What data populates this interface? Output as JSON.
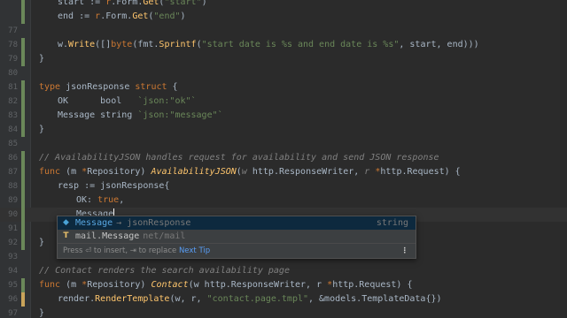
{
  "editor": {
    "lines": [
      {
        "num": "",
        "parts": [
          [
            "",
            "start := "
          ],
          [
            "kw",
            "r"
          ],
          [
            "",
            ".Form."
          ],
          [
            "fn",
            "Get"
          ],
          [
            "",
            "("
          ],
          [
            "str",
            "\"start\""
          ],
          [
            "",
            ")"
          ]
        ]
      },
      {
        "num": "",
        "parts": [
          [
            "",
            "end := "
          ],
          [
            "kw",
            "r"
          ],
          [
            "",
            ".Form."
          ],
          [
            "fn",
            "Get"
          ],
          [
            "",
            "("
          ],
          [
            "str",
            "\"end\""
          ],
          [
            "",
            ")"
          ]
        ]
      },
      {
        "num": "77",
        "parts": []
      },
      {
        "num": "78",
        "parts": [
          [
            "",
            "w."
          ],
          [
            "fn",
            "Write"
          ],
          [
            "",
            "([]"
          ],
          [
            "kw",
            "byte"
          ],
          [
            "",
            "(fmt."
          ],
          [
            "fn",
            "Sprintf"
          ],
          [
            "",
            "("
          ],
          [
            "str",
            "\"start date is %s and end date is %s\""
          ],
          [
            "",
            ", start, end)))"
          ]
        ]
      },
      {
        "num": "79",
        "parts": [
          [
            "",
            "}"
          ]
        ]
      },
      {
        "num": "80",
        "parts": []
      },
      {
        "num": "81",
        "parts": [
          [
            "kw",
            "type "
          ],
          [
            "",
            "jsonResponse "
          ],
          [
            "kw",
            "struct "
          ],
          [
            "",
            "{"
          ]
        ]
      },
      {
        "num": "82",
        "parts": [
          [
            "",
            "OK      bool   "
          ],
          [
            "tag",
            "`json:\"ok\"`"
          ]
        ]
      },
      {
        "num": "83",
        "parts": [
          [
            "",
            "Message string "
          ],
          [
            "tag",
            "`json:\"message\"`"
          ]
        ]
      },
      {
        "num": "84",
        "parts": [
          [
            "",
            "}"
          ]
        ]
      },
      {
        "num": "85",
        "parts": []
      },
      {
        "num": "86",
        "parts": [
          [
            "cmt",
            "// AvailabilityJSON handles request for availability and send JSON response"
          ]
        ]
      },
      {
        "num": "87",
        "parts": [
          [
            "kw",
            "func "
          ],
          [
            "",
            "(m "
          ],
          [
            "kw",
            "*"
          ],
          [
            "",
            "Repository) "
          ],
          [
            "fn italic",
            "AvailabilityJSON"
          ],
          [
            "",
            "("
          ],
          [
            "cmt",
            "w"
          ],
          [
            "",
            " http.ResponseWriter, "
          ],
          [
            "cmt",
            "r"
          ],
          [
            "",
            " "
          ],
          [
            "kw",
            "*"
          ],
          [
            "",
            "http.Request) {"
          ]
        ]
      },
      {
        "num": "88",
        "parts": [
          [
            "",
            "resp := jsonResponse{"
          ]
        ]
      },
      {
        "num": "89",
        "parts": [
          [
            "",
            "OK: "
          ],
          [
            "kw",
            "true"
          ],
          [
            "",
            ","
          ]
        ]
      },
      {
        "num": "90",
        "parts": [
          [
            "",
            "Message"
          ]
        ]
      },
      {
        "num": "91",
        "parts": []
      },
      {
        "num": "92",
        "parts": [
          [
            "",
            "}"
          ]
        ]
      },
      {
        "num": "93",
        "parts": []
      },
      {
        "num": "94",
        "parts": [
          [
            "cmt",
            "// "
          ],
          [
            "cmt",
            "Contact"
          ],
          [
            "cmt",
            " renders the search availability page"
          ]
        ]
      },
      {
        "num": "95",
        "parts": [
          [
            "kw",
            "func "
          ],
          [
            "",
            "(m "
          ],
          [
            "kw",
            "*"
          ],
          [
            "",
            "Repository) "
          ],
          [
            "fn italic",
            "Contact"
          ],
          [
            "",
            "(w http.ResponseWriter, r "
          ],
          [
            "kw",
            "*"
          ],
          [
            "",
            "http.Request) {"
          ]
        ]
      },
      {
        "num": "96",
        "parts": [
          [
            "",
            "render."
          ],
          [
            "fn",
            "RenderTemplate"
          ],
          [
            "",
            "(w, r, "
          ],
          [
            "str",
            "\"contact.page.tmpl\""
          ],
          [
            "",
            ", &models.TemplateData{})"
          ]
        ]
      },
      {
        "num": "97",
        "parts": [
          [
            "",
            "}"
          ]
        ]
      }
    ]
  },
  "completion": {
    "items": [
      {
        "icon": "tag-icon",
        "glyph": "◆",
        "match": "Message",
        "rest": "",
        "hint": "→ jsonResponse",
        "type": "string"
      },
      {
        "icon": "type-icon",
        "glyph": "T",
        "prefix": "mail.",
        "match": "Message",
        "rest": "",
        "hint": "net/mail",
        "type": ""
      }
    ],
    "footer_prefix": "Press ⏎ to insert, ⇥ to replace",
    "footer_link": "Next Tip",
    "menu": "⋮"
  }
}
